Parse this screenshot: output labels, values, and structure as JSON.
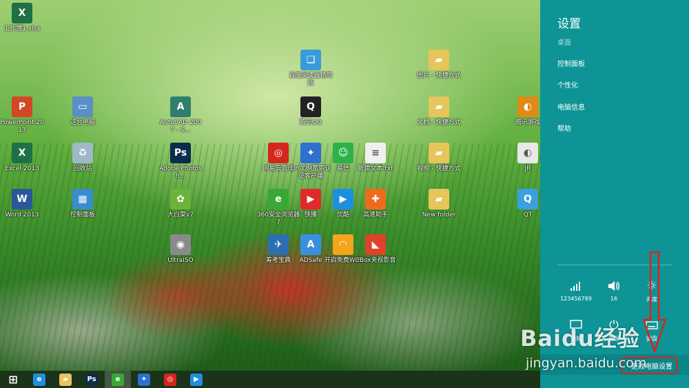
{
  "desktop_icons": [
    {
      "label": "工作簿1.xlsx",
      "icon": "excel-file-icon",
      "color": "#1e7145",
      "glyph": "X"
    },
    {
      "label": "PowerPoint 2013",
      "icon": "powerpoint-icon",
      "color": "#d24726",
      "glyph": "P"
    },
    {
      "label": "Excel 2013",
      "icon": "excel-icon",
      "color": "#1e7145",
      "glyph": "X"
    },
    {
      "label": "Word 2013",
      "icon": "word-icon",
      "color": "#2b579a",
      "glyph": "W"
    },
    {
      "label": "这台电脑",
      "icon": "computer-icon",
      "color": "#5a8fc8",
      "glyph": "▭"
    },
    {
      "label": "回收站",
      "icon": "recycle-bin-icon",
      "color": "#a0b8c8",
      "glyph": "♻"
    },
    {
      "label": "控制面板",
      "icon": "control-panel-icon",
      "color": "#3a8bd0",
      "glyph": "▦"
    },
    {
      "label": "AutoCAD 2007 - S...",
      "icon": "autocad-icon",
      "color": "#2f7f6e",
      "glyph": "A"
    },
    {
      "label": "Adobe Photosh...",
      "icon": "photoshop-icon",
      "color": "#0c2c4d",
      "glyph": "Ps"
    },
    {
      "label": "大白菜v7",
      "icon": "dabaicai-icon",
      "color": "#6bb33a",
      "glyph": "✿"
    },
    {
      "label": "UltraISO",
      "icon": "ultraiso-icon",
      "color": "#8a8a8a",
      "glyph": "◉"
    },
    {
      "label": "百度阅读器精简版",
      "icon": "baidu-reader-icon",
      "color": "#3a9bdc",
      "glyph": "❏"
    },
    {
      "label": "腾讯QQ",
      "icon": "qq-icon",
      "color": "#222222",
      "glyph": "Q"
    },
    {
      "label": "网易云音乐",
      "icon": "netease-music-icon",
      "color": "#d4261e",
      "glyph": "◎"
    },
    {
      "label": "DrCOM宽带认证客户端",
      "icon": "drcom-icon",
      "color": "#2e6fcf",
      "glyph": "✦"
    },
    {
      "label": "易信",
      "icon": "yixin-icon",
      "color": "#2bb34a",
      "glyph": "☺"
    },
    {
      "label": "新建文本.txt",
      "icon": "text-file-icon",
      "color": "#f0f0f0",
      "glyph": "≡"
    },
    {
      "label": "360安全浏览器7",
      "icon": "360-browser-icon",
      "color": "#3aa835",
      "glyph": "e"
    },
    {
      "label": "快播",
      "icon": "qvod-icon",
      "color": "#e02a2a",
      "glyph": "▶"
    },
    {
      "label": "优酷",
      "icon": "youku-icon",
      "color": "#1e8fe0",
      "glyph": "▶"
    },
    {
      "label": "高速助手",
      "icon": "speed-helper-icon",
      "color": "#ef6a1f",
      "glyph": "✚"
    },
    {
      "label": "筹考宝典",
      "icon": "exam-icon",
      "color": "#2a6fb0",
      "glyph": "✈"
    },
    {
      "label": "ADSafe",
      "icon": "adsafe-icon",
      "color": "#3b8fe0",
      "glyph": "A"
    },
    {
      "label": "开启免费WiFi",
      "icon": "wifi-icon",
      "color": "#f3a51b",
      "glyph": "◠"
    },
    {
      "label": "CBox央视影音",
      "icon": "cbox-icon",
      "color": "#e0412a",
      "glyph": "◣"
    },
    {
      "label": "图片 - 快捷方式",
      "icon": "folder-shortcut-icon",
      "color": "#e6c55a",
      "glyph": "▰"
    },
    {
      "label": "文档 - 快捷方式",
      "icon": "folder-shortcut-icon",
      "color": "#e6c55a",
      "glyph": "▰"
    },
    {
      "label": "视频 - 快捷方式",
      "icon": "folder-shortcut-icon",
      "color": "#e6c55a",
      "glyph": "▰"
    },
    {
      "label": "New folder",
      "icon": "folder-icon",
      "color": "#e6c55a",
      "glyph": "▰"
    },
    {
      "label": "腾讯游戏",
      "icon": "tencent-games-icon",
      "color": "#e08a1a",
      "glyph": "◐"
    },
    {
      "label": "JR",
      "icon": "jr-icon",
      "color": "#e8e8e8",
      "glyph": "◐"
    },
    {
      "label": "QT",
      "icon": "qt-icon",
      "color": "#3aa0e0",
      "glyph": "Q"
    }
  ],
  "taskbar": {
    "items": [
      {
        "icon": "start-icon",
        "color": "#ffffff",
        "glyph": "⊞"
      },
      {
        "icon": "internet-explorer-icon",
        "color": "#1e8fe0",
        "glyph": "e"
      },
      {
        "icon": "file-explorer-icon",
        "color": "#e6c55a",
        "glyph": "▰"
      },
      {
        "icon": "photoshop-icon",
        "color": "#0c2c4d",
        "glyph": "Ps"
      },
      {
        "icon": "360-browser-icon",
        "color": "#3aa835",
        "glyph": "e"
      },
      {
        "icon": "drcom-icon",
        "color": "#2e6fcf",
        "glyph": "✦"
      },
      {
        "icon": "netease-music-icon",
        "color": "#d4261e",
        "glyph": "◎"
      },
      {
        "icon": "youku-icon",
        "color": "#1e8fe0",
        "glyph": "▶"
      }
    ]
  },
  "settings": {
    "title": "设置",
    "context": "桌面",
    "links": [
      "控制面板",
      "个性化",
      "电脑信息",
      "帮助"
    ],
    "quick": [
      {
        "icon": "network-icon",
        "label": "123456789"
      },
      {
        "icon": "volume-icon",
        "label": "16"
      },
      {
        "icon": "brightness-icon",
        "label": "亮度"
      },
      {
        "icon": "notifications-icon",
        "label": "通知"
      },
      {
        "icon": "power-icon",
        "label": "电源"
      },
      {
        "icon": "keyboard-icon",
        "label": "键盘"
      }
    ],
    "change_pc_settings": "更改电脑设置"
  },
  "watermark": {
    "brand": "Baidu经验",
    "url": "jingyan.baidu.com"
  },
  "colors": {
    "charm_bg": "#0e9496",
    "annotation": "#e0201a"
  }
}
